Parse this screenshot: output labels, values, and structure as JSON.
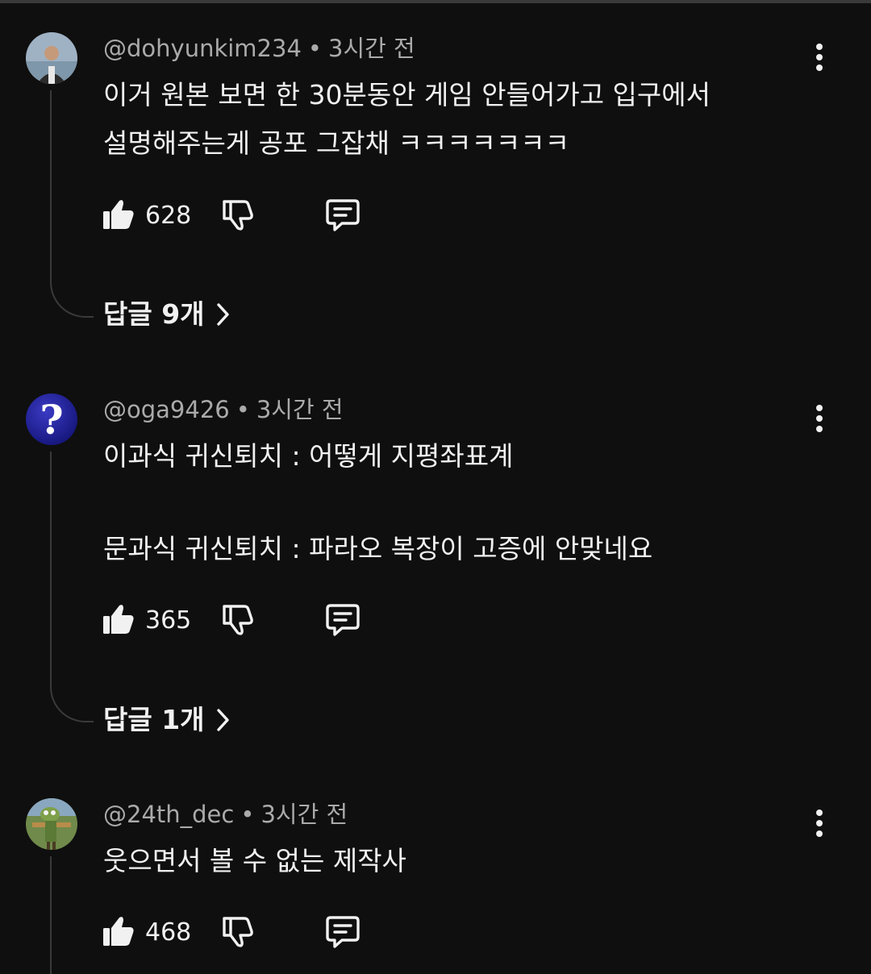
{
  "comments": [
    {
      "handle": "@dohyunkim234",
      "time": "3시간 전",
      "lines": [
        "이거 원본 보면 한 30분동안 게임 안들어가고 입구에서",
        "설명해주는게 공포 그잡채 ㅋㅋㅋㅋㅋㅋㅋ"
      ],
      "likes": "628",
      "replies": "답글 9개"
    },
    {
      "handle": "@oga9426",
      "time": "3시간 전",
      "lines": [
        "이과식 귀신퇴치 : 어떻게 지평좌표계",
        "문과식 귀신퇴치 : 파라오 복장이 고증에 안맞네요"
      ],
      "likes": "365",
      "replies": "답글 1개"
    },
    {
      "handle": "@24th_dec",
      "time": "3시간 전",
      "lines": [
        "웃으면서 볼 수 없는 제작사"
      ],
      "likes": "468"
    }
  ],
  "separator": "•",
  "icons": {
    "like": "thumbs-up-icon",
    "dislike": "thumbs-down-icon",
    "reply": "comment-icon",
    "more": "more-vert-icon",
    "chevron": "chevron-right-icon"
  },
  "colors": {
    "background": "#0f0f0f",
    "text": "#f1f1f1",
    "secondary": "#aaaaaa",
    "thread": "#3a3a3a"
  }
}
